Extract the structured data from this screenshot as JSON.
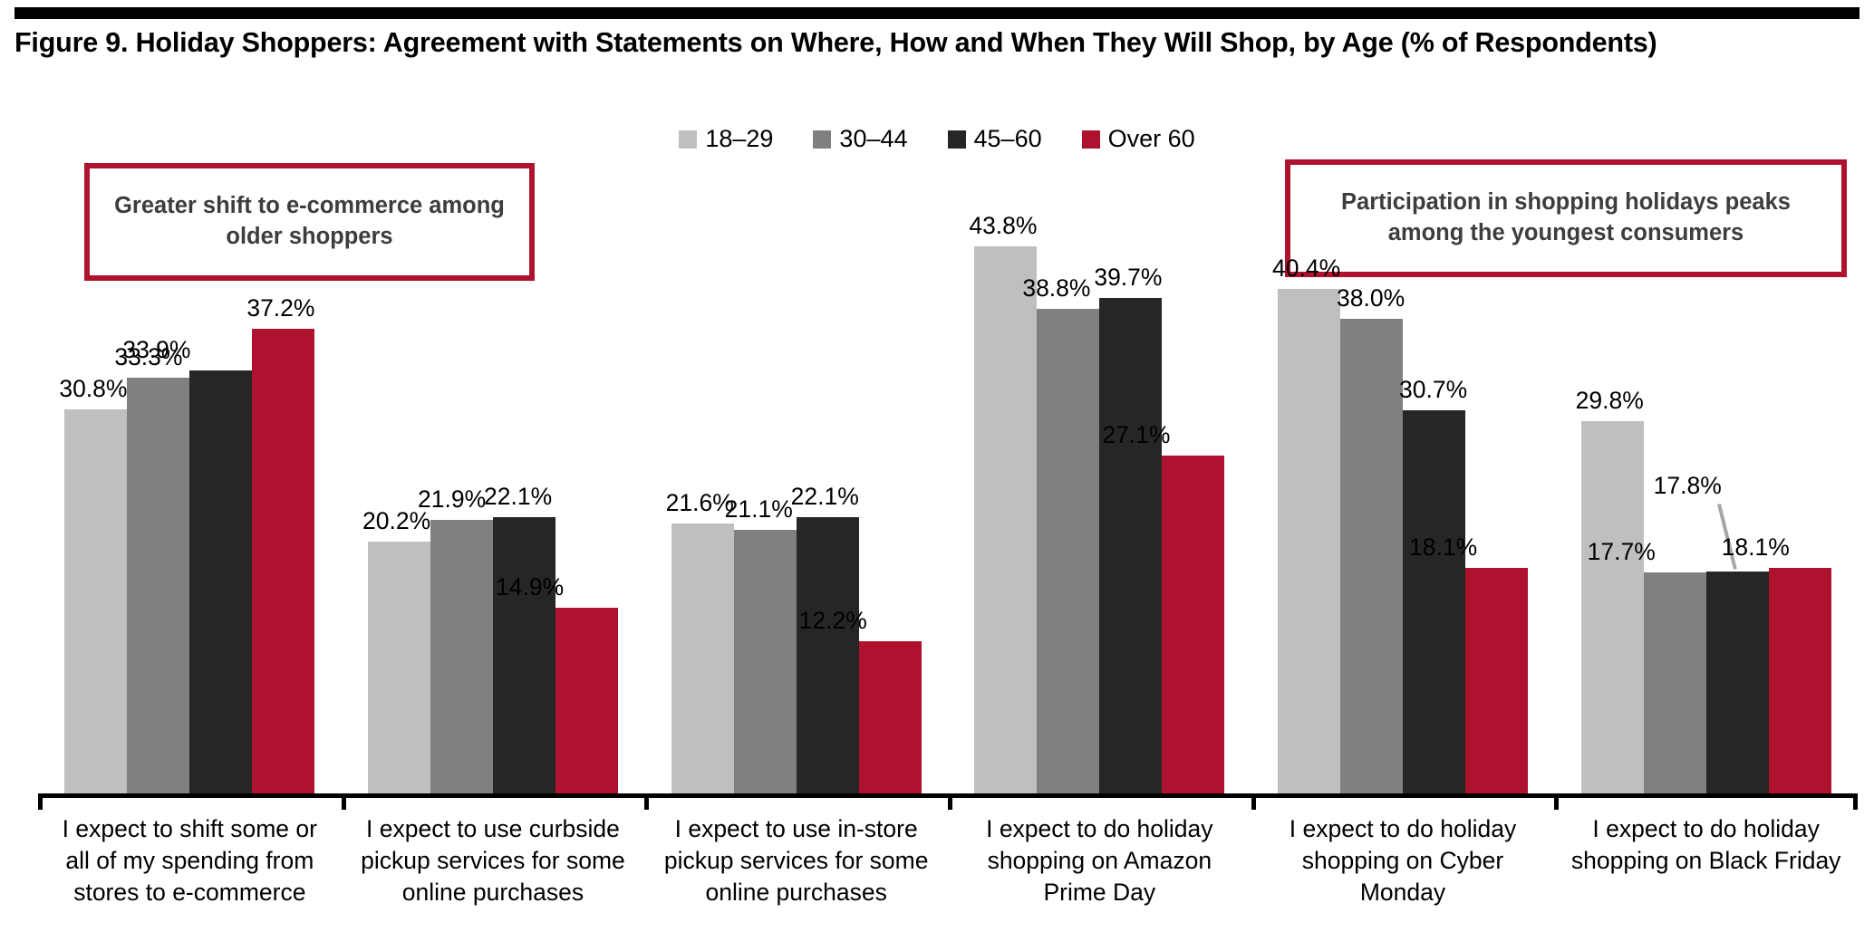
{
  "title": "Figure 9. Holiday Shoppers: Agreement with Statements on Where, How and When They Will Shop, by Age (% of Respondents)",
  "legend": {
    "items": [
      {
        "label": "18–29",
        "color": "#BFBFBF",
        "swatch": "legend-swatch-18-29"
      },
      {
        "label": "30–44",
        "color": "#808080",
        "swatch": "legend-swatch-30-44"
      },
      {
        "label": "45–60",
        "color": "#262626",
        "swatch": "legend-swatch-45-60"
      },
      {
        "label": "Over 60",
        "color": "#AF122F",
        "swatch": "legend-swatch-over-60"
      }
    ]
  },
  "callouts": {
    "left": "Greater shift to e-commerce among older shoppers",
    "right": "Participation in shopping holidays peaks among the youngest consumers"
  },
  "colors": {
    "series_18_29": "#BFBFBF",
    "series_30_44": "#808080",
    "series_45_60": "#262626",
    "series_over_60": "#AF122F",
    "accent_border": "#AF122F",
    "callout_text": "#3D3D3D",
    "axis": "#000000",
    "leader_line": "#A6A6A6"
  },
  "chart_data": {
    "type": "bar",
    "title": "Figure 9. Holiday Shoppers: Agreement with Statements on Where, How and When They Will Shop, by Age (% of Respondents)",
    "xlabel": "",
    "ylabel": "",
    "ylim": [
      0,
      48
    ],
    "grid": false,
    "legend_position": "top-center",
    "value_suffix": "%",
    "categories": [
      "I expect to shift some or all of my spending from stores to e-commerce",
      "I expect to use curbside pickup services for some online purchases",
      "I expect to use in-store pickup services for some online purchases",
      "I expect to do holiday shopping on Amazon Prime Day",
      "I expect to do holiday shopping on Cyber Monday",
      "I expect to do holiday shopping on Black Friday"
    ],
    "category_lines": [
      [
        "I expect to shift some or",
        "all of my spending from",
        "stores to e-commerce"
      ],
      [
        "I expect to use curbside",
        "pickup services for some",
        "online purchases"
      ],
      [
        "I expect to use in-store",
        "pickup services for some",
        "online purchases"
      ],
      [
        "I expect to do holiday",
        "shopping on Amazon",
        "Prime Day"
      ],
      [
        "I expect to do holiday",
        "shopping on Cyber",
        "Monday"
      ],
      [
        "I expect to do holiday",
        "shopping on Black Friday"
      ]
    ],
    "series": [
      {
        "name": "18–29",
        "color": "#BFBFBF",
        "values": [
          30.8,
          20.2,
          21.6,
          43.8,
          40.4,
          29.8
        ],
        "labels": [
          "30.8%",
          "20.2%",
          "21.6%",
          "43.8%",
          "40.4%",
          "29.8%"
        ]
      },
      {
        "name": "30–44",
        "color": "#808080",
        "values": [
          33.3,
          21.9,
          21.1,
          38.8,
          38.0,
          17.7
        ],
        "labels": [
          "33.3%",
          "21.9%",
          "21.1%",
          "38.8%",
          "38.0%",
          "17.7%"
        ]
      },
      {
        "name": "45–60",
        "color": "#262626",
        "values": [
          33.9,
          22.1,
          22.1,
          39.7,
          30.7,
          17.8
        ],
        "labels": [
          "33.9%",
          "22.1%",
          "22.1%",
          "39.7%",
          "30.7%",
          "17.8%"
        ]
      },
      {
        "name": "Over 60",
        "color": "#AF122F",
        "values": [
          37.2,
          14.9,
          12.2,
          27.1,
          18.1,
          18.1
        ],
        "labels": [
          "37.2%",
          "14.9%",
          "12.2%",
          "27.1%",
          "18.1%",
          "18.1%"
        ]
      }
    ]
  }
}
